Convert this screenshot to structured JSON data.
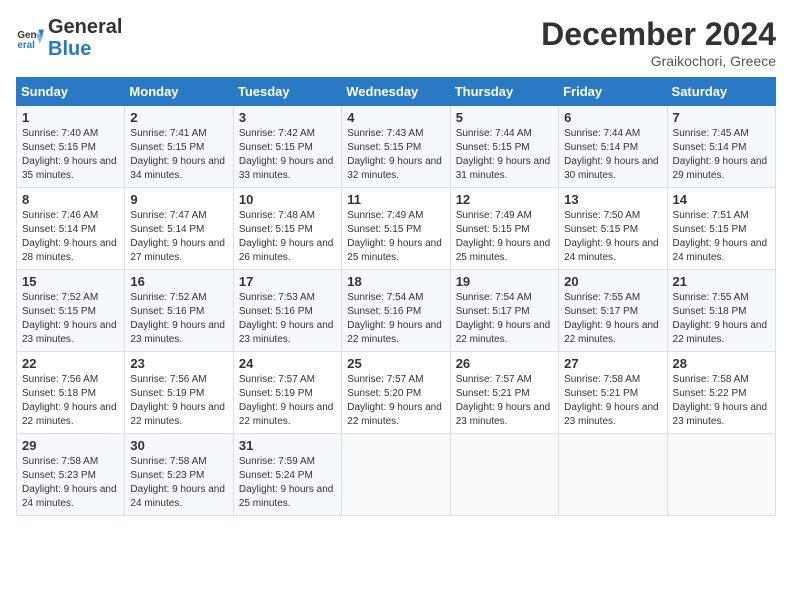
{
  "logo": {
    "line1": "General",
    "line2": "Blue"
  },
  "title": "December 2024",
  "location": "Graikochori, Greece",
  "days_header": [
    "Sunday",
    "Monday",
    "Tuesday",
    "Wednesday",
    "Thursday",
    "Friday",
    "Saturday"
  ],
  "weeks": [
    [
      {
        "day": "1",
        "sunrise": "7:40 AM",
        "sunset": "5:15 PM",
        "daylight": "9 hours and 35 minutes."
      },
      {
        "day": "2",
        "sunrise": "7:41 AM",
        "sunset": "5:15 PM",
        "daylight": "9 hours and 34 minutes."
      },
      {
        "day": "3",
        "sunrise": "7:42 AM",
        "sunset": "5:15 PM",
        "daylight": "9 hours and 33 minutes."
      },
      {
        "day": "4",
        "sunrise": "7:43 AM",
        "sunset": "5:15 PM",
        "daylight": "9 hours and 32 minutes."
      },
      {
        "day": "5",
        "sunrise": "7:44 AM",
        "sunset": "5:15 PM",
        "daylight": "9 hours and 31 minutes."
      },
      {
        "day": "6",
        "sunrise": "7:44 AM",
        "sunset": "5:14 PM",
        "daylight": "9 hours and 30 minutes."
      },
      {
        "day": "7",
        "sunrise": "7:45 AM",
        "sunset": "5:14 PM",
        "daylight": "9 hours and 29 minutes."
      }
    ],
    [
      {
        "day": "8",
        "sunrise": "7:46 AM",
        "sunset": "5:14 PM",
        "daylight": "9 hours and 28 minutes."
      },
      {
        "day": "9",
        "sunrise": "7:47 AM",
        "sunset": "5:14 PM",
        "daylight": "9 hours and 27 minutes."
      },
      {
        "day": "10",
        "sunrise": "7:48 AM",
        "sunset": "5:15 PM",
        "daylight": "9 hours and 26 minutes."
      },
      {
        "day": "11",
        "sunrise": "7:49 AM",
        "sunset": "5:15 PM",
        "daylight": "9 hours and 25 minutes."
      },
      {
        "day": "12",
        "sunrise": "7:49 AM",
        "sunset": "5:15 PM",
        "daylight": "9 hours and 25 minutes."
      },
      {
        "day": "13",
        "sunrise": "7:50 AM",
        "sunset": "5:15 PM",
        "daylight": "9 hours and 24 minutes."
      },
      {
        "day": "14",
        "sunrise": "7:51 AM",
        "sunset": "5:15 PM",
        "daylight": "9 hours and 24 minutes."
      }
    ],
    [
      {
        "day": "15",
        "sunrise": "7:52 AM",
        "sunset": "5:15 PM",
        "daylight": "9 hours and 23 minutes."
      },
      {
        "day": "16",
        "sunrise": "7:52 AM",
        "sunset": "5:16 PM",
        "daylight": "9 hours and 23 minutes."
      },
      {
        "day": "17",
        "sunrise": "7:53 AM",
        "sunset": "5:16 PM",
        "daylight": "9 hours and 23 minutes."
      },
      {
        "day": "18",
        "sunrise": "7:54 AM",
        "sunset": "5:16 PM",
        "daylight": "9 hours and 22 minutes."
      },
      {
        "day": "19",
        "sunrise": "7:54 AM",
        "sunset": "5:17 PM",
        "daylight": "9 hours and 22 minutes."
      },
      {
        "day": "20",
        "sunrise": "7:55 AM",
        "sunset": "5:17 PM",
        "daylight": "9 hours and 22 minutes."
      },
      {
        "day": "21",
        "sunrise": "7:55 AM",
        "sunset": "5:18 PM",
        "daylight": "9 hours and 22 minutes."
      }
    ],
    [
      {
        "day": "22",
        "sunrise": "7:56 AM",
        "sunset": "5:18 PM",
        "daylight": "9 hours and 22 minutes."
      },
      {
        "day": "23",
        "sunrise": "7:56 AM",
        "sunset": "5:19 PM",
        "daylight": "9 hours and 22 minutes."
      },
      {
        "day": "24",
        "sunrise": "7:57 AM",
        "sunset": "5:19 PM",
        "daylight": "9 hours and 22 minutes."
      },
      {
        "day": "25",
        "sunrise": "7:57 AM",
        "sunset": "5:20 PM",
        "daylight": "9 hours and 22 minutes."
      },
      {
        "day": "26",
        "sunrise": "7:57 AM",
        "sunset": "5:21 PM",
        "daylight": "9 hours and 23 minutes."
      },
      {
        "day": "27",
        "sunrise": "7:58 AM",
        "sunset": "5:21 PM",
        "daylight": "9 hours and 23 minutes."
      },
      {
        "day": "28",
        "sunrise": "7:58 AM",
        "sunset": "5:22 PM",
        "daylight": "9 hours and 23 minutes."
      }
    ],
    [
      {
        "day": "29",
        "sunrise": "7:58 AM",
        "sunset": "5:23 PM",
        "daylight": "9 hours and 24 minutes."
      },
      {
        "day": "30",
        "sunrise": "7:58 AM",
        "sunset": "5:23 PM",
        "daylight": "9 hours and 24 minutes."
      },
      {
        "day": "31",
        "sunrise": "7:59 AM",
        "sunset": "5:24 PM",
        "daylight": "9 hours and 25 minutes."
      },
      null,
      null,
      null,
      null
    ]
  ]
}
